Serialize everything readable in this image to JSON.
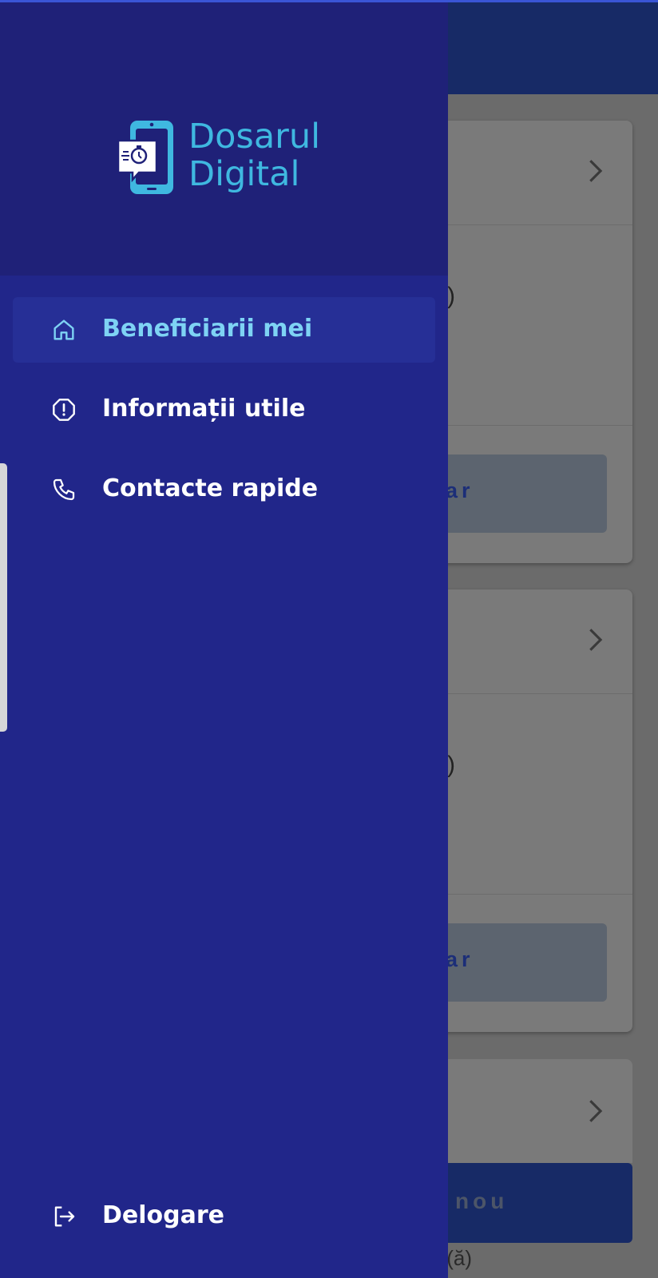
{
  "app": {
    "logo_line1": "Dosarul",
    "logo_line2": "Digital"
  },
  "drawer": {
    "items": [
      {
        "label": "Beneficiarii mei",
        "icon": "home-icon",
        "active": true
      },
      {
        "label": "Informații utile",
        "icon": "info-octagon-icon",
        "active": false
      },
      {
        "label": "Contacte rapide",
        "icon": "phone-icon",
        "active": false
      }
    ],
    "logout": {
      "label": "Delogare",
      "icon": "logout-icon"
    }
  },
  "background": {
    "card1": {
      "partial_text": ")",
      "button_text": "ar"
    },
    "card2": {
      "partial_text": ")",
      "button_text": "ar"
    },
    "primary_button_text": "nou",
    "footer_text": "t(ă)"
  },
  "colors": {
    "drawer_bg": "#21268a",
    "drawer_header_bg": "#1f2178",
    "active_item_bg": "#262f96",
    "active_label": "#7ed3f4",
    "logo_accent": "#3fb8e0"
  }
}
